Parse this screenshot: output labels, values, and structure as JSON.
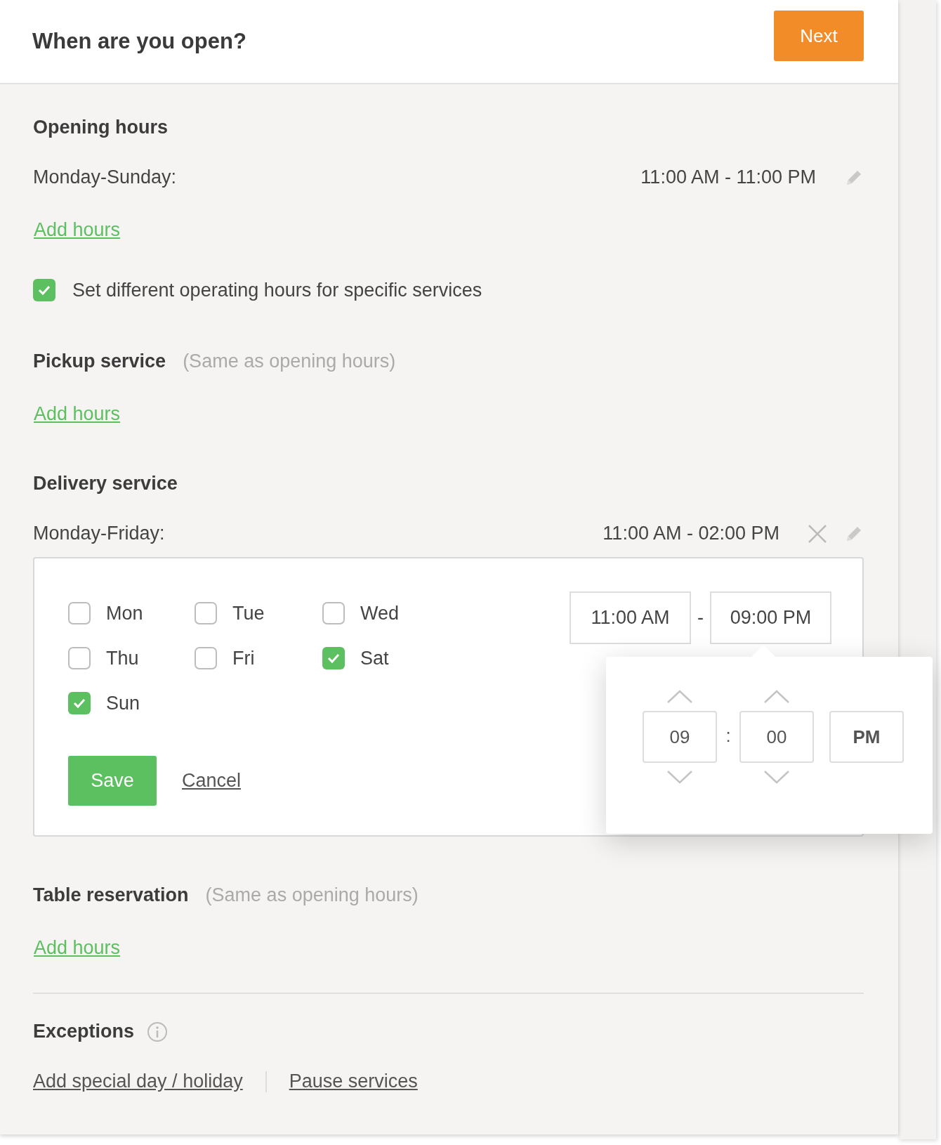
{
  "header": {
    "title": "When are you open?",
    "next_button": "Next"
  },
  "opening_hours": {
    "heading": "Opening hours",
    "rows": [
      {
        "days": "Monday-Sunday:",
        "hours": "11:00 AM - 11:00 PM",
        "removable": false
      }
    ],
    "add_link": "Add hours"
  },
  "different_hours": {
    "label": "Set different operating hours for specific services",
    "checked": true
  },
  "services": [
    {
      "heading": "Pickup service",
      "note": "(Same as opening hours)",
      "add_link": "Add hours"
    },
    {
      "heading": "Delivery service",
      "rows": [
        {
          "days": "Monday-Friday:",
          "hours": "11:00 AM - 02:00 PM",
          "removable": true
        }
      ],
      "editor": {
        "days": [
          {
            "label": "Mon",
            "checked": false
          },
          {
            "label": "Tue",
            "checked": false
          },
          {
            "label": "Wed",
            "checked": false
          },
          {
            "label": "Thu",
            "checked": false
          },
          {
            "label": "Fri",
            "checked": false
          },
          {
            "label": "Sat",
            "checked": true
          },
          {
            "label": "Sun",
            "checked": true
          }
        ],
        "from": "11:00 AM",
        "separator": "-",
        "to": "09:00 PM",
        "save": "Save",
        "cancel": "Cancel",
        "picker": {
          "hour": "09",
          "separator": ":",
          "minute": "00",
          "period": "PM"
        }
      }
    },
    {
      "heading": "Table reservation",
      "note": "(Same as opening hours)",
      "add_link": "Add hours"
    }
  ],
  "exceptions": {
    "heading": "Exceptions",
    "links": [
      "Add special day / holiday",
      "Pause services"
    ]
  }
}
